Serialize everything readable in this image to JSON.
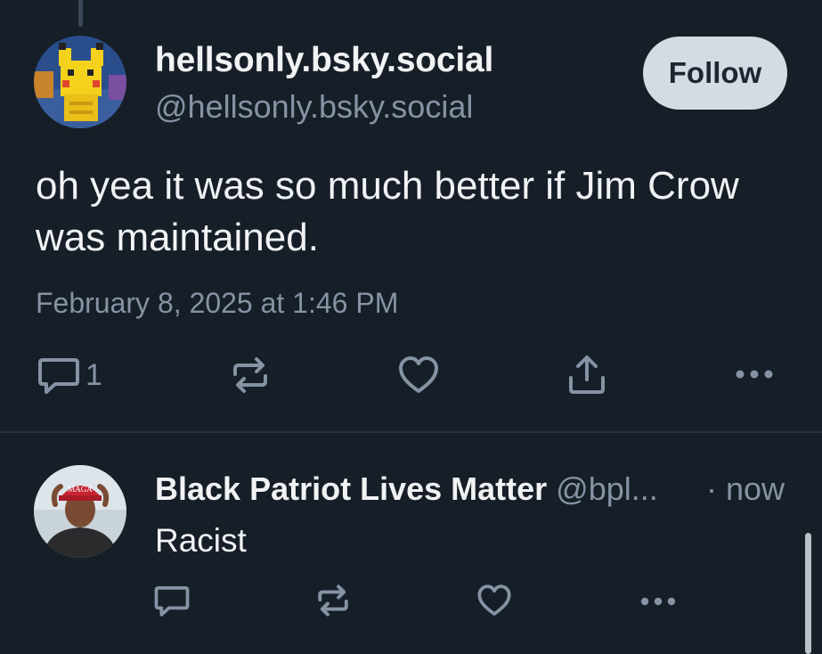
{
  "main_post": {
    "display_name": "hellsonly.bsky.social",
    "handle": "@hellsonly.bsky.social",
    "follow_label": "Follow",
    "text": "oh yea it was so much better if Jim Crow was maintained.",
    "timestamp": "February 8, 2025 at 1:46 PM",
    "actions": {
      "reply_count": "1",
      "reply_icon": "reply-icon",
      "repost_icon": "repost-icon",
      "like_icon": "heart-icon",
      "share_icon": "share-icon",
      "more_icon": "more-icon"
    }
  },
  "reply": {
    "display_name": "Black Patriot Lives Matter",
    "handle": "@bpl...",
    "time": "· now",
    "text": "Racist",
    "avatar_hat_text": "MAGA",
    "actions": {
      "reply_icon": "reply-icon",
      "repost_icon": "repost-icon",
      "like_icon": "heart-icon",
      "more_icon": "more-icon"
    }
  },
  "colors": {
    "background": "#161e27",
    "text_primary": "#f1f3f5",
    "text_secondary": "#8593a4",
    "follow_button_bg": "#d4dbe3"
  }
}
